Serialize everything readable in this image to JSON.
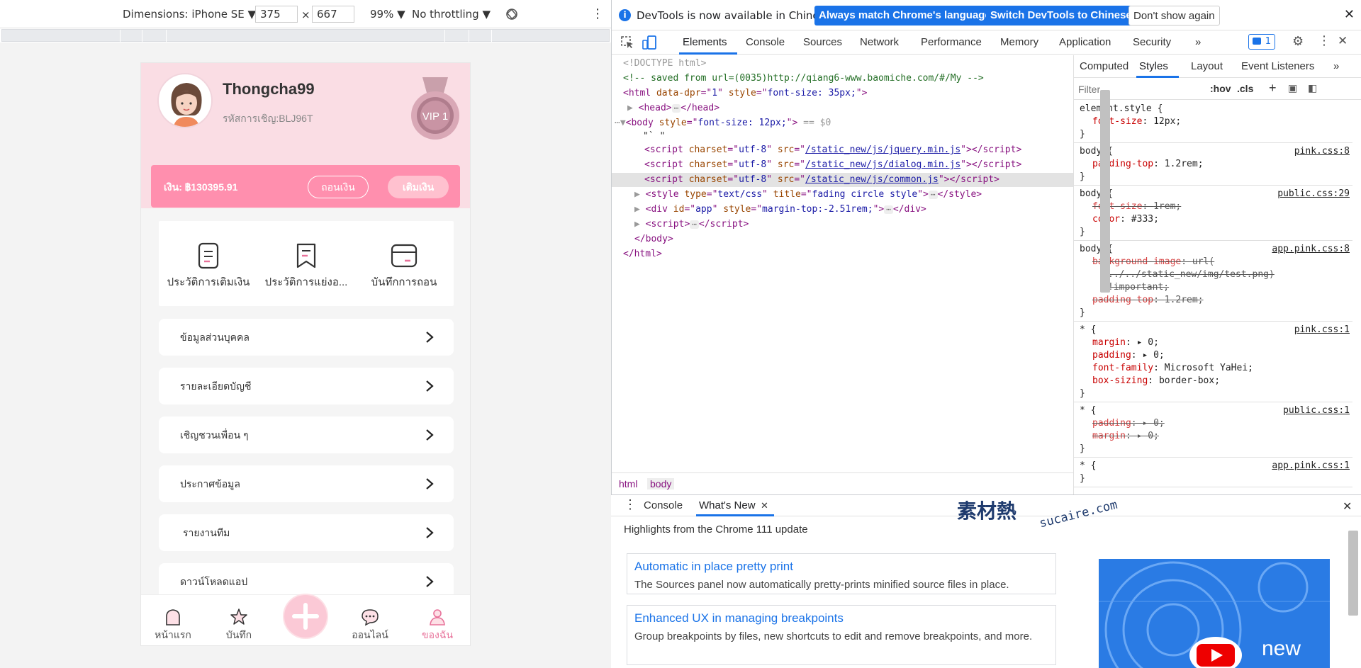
{
  "device_toolbar": {
    "dimensions": "Dimensions: iPhone SE ▼",
    "width": "375",
    "height": "667",
    "times": "×",
    "zoom": "99% ▼",
    "throttling": "No throttling ▼"
  },
  "phone": {
    "username": "Thongcha99",
    "invite_code": "รหัสการเชิญ:BLJ96T",
    "vip_label": "VIP 1",
    "balance": "เงิน:  ฿130395.91",
    "withdraw": "ถอนเงิน",
    "deposit": "เติมเงิน",
    "quick_items": [
      "ประวัติการเติมเงิน",
      "ประวัติการแย่งอ...",
      "บันทึกการถอน"
    ],
    "menu": [
      "ข้อมูลส่วนบุคคล",
      "รายละเอียดบัญชี",
      "เชิญชวนเพื่อน ๆ",
      "ประกาศข้อมูล",
      "รายงานทีม",
      "ดาวน์โหลดแอป"
    ],
    "tabs": [
      "หน้าแรก",
      "บันทึก",
      "ออนไลน์",
      "ของฉัน"
    ],
    "colors": {
      "pink": "#ff8fae",
      "active_tab": "#e8729a"
    }
  },
  "devtools": {
    "info": {
      "message": "DevTools is now available in Chinese!",
      "btn1": "Always match Chrome's language",
      "btn2": "Switch DevTools to Chinese",
      "btn3": "Don't show again"
    },
    "tabs": [
      "Elements",
      "Console",
      "Sources",
      "Network",
      "Performance",
      "Memory",
      "Application",
      "Security",
      "»"
    ],
    "issues_count": "1",
    "elements": {
      "l1": "<!DOCTYPE html>",
      "l2": "<!-- saved from url=(0035)http://qiang6-www.baomiche.com/#/My -->",
      "l3a": "<html ",
      "l3b": "data-dpr",
      "l3c": "=\"",
      "l3d": "1",
      "l3e": "\" ",
      "l3f": "style",
      "l3g": "=\"",
      "l3h": "font-size: 35px;",
      "l3i": "\">",
      "l4a": "<head>",
      "l4b": "</head>",
      "l5a": "<body ",
      "l5b": "style",
      "l5c": "font-size: 12px;",
      "l5d": "== $0",
      "l6": "\"` \"",
      "s1": "/static_new/js/jquery.min.js",
      "s2": "/static_new/js/dialog.min.js",
      "s3": "/static_new/js/common.js",
      "style_title": "fading circle style",
      "div_style": "margin-top:-2.51rem;",
      "body_close": "</body>",
      "html_close": "</html>"
    },
    "breadcrumbs": [
      "html",
      "body"
    ],
    "styles_tabs": [
      "Computed",
      "Styles",
      "Layout",
      "Event Listeners",
      "»"
    ],
    "filter_placeholder": "Filter",
    "hov": ":hov",
    "cls": ".cls",
    "rules": [
      {
        "sel": "element.style {",
        "src": "",
        "props": [
          [
            "font-size",
            "12px;",
            false
          ]
        ]
      },
      {
        "sel": "body {",
        "src": "pink.css:8",
        "props": [
          [
            "padding-top",
            "1.2rem;",
            false
          ]
        ]
      },
      {
        "sel": "body {",
        "src": "public.css:29",
        "props": [
          [
            "font-size",
            "1rem;",
            true
          ],
          [
            "color",
            "#333;",
            false
          ]
        ]
      },
      {
        "sel": "body {",
        "src": "app.pink.css:8",
        "props": [
          [
            "background-image",
            "url(",
            true
          ],
          [
            "",
            "../../static_new/img/test.png)",
            true
          ],
          [
            "",
            "!important;",
            true
          ],
          [
            "padding-top",
            "1.2rem;",
            true
          ]
        ]
      },
      {
        "sel": "* {",
        "src": "pink.css:1",
        "props": [
          [
            "margin",
            "▸ 0;",
            false
          ],
          [
            "padding",
            "▸ 0;",
            false
          ],
          [
            "font-family",
            "Microsoft YaHei;",
            false
          ],
          [
            "box-sizing",
            "border-box;",
            false
          ]
        ]
      },
      {
        "sel": "* {",
        "src": "public.css:1",
        "props": [
          [
            "padding",
            "▸ 0;",
            true
          ],
          [
            "margin",
            "▸ 0;",
            true
          ]
        ]
      },
      {
        "sel": "* {",
        "src": "app.pink.css:1",
        "props": []
      }
    ],
    "drawer": {
      "tabs": [
        "Console",
        "What's New"
      ],
      "highlights": "Highlights from the Chrome 111 update",
      "cards": [
        {
          "title": "Automatic in place pretty print",
          "desc": "The Sources panel now automatically pretty-prints minified source files in place."
        },
        {
          "title": "Enhanced UX in managing breakpoints",
          "desc": "Group breakpoints by files, new shortcuts to edit and remove breakpoints, and more."
        }
      ],
      "promo_text": "new"
    }
  },
  "watermark": {
    "logo": "素材熱",
    "url": "sucaire.com"
  }
}
